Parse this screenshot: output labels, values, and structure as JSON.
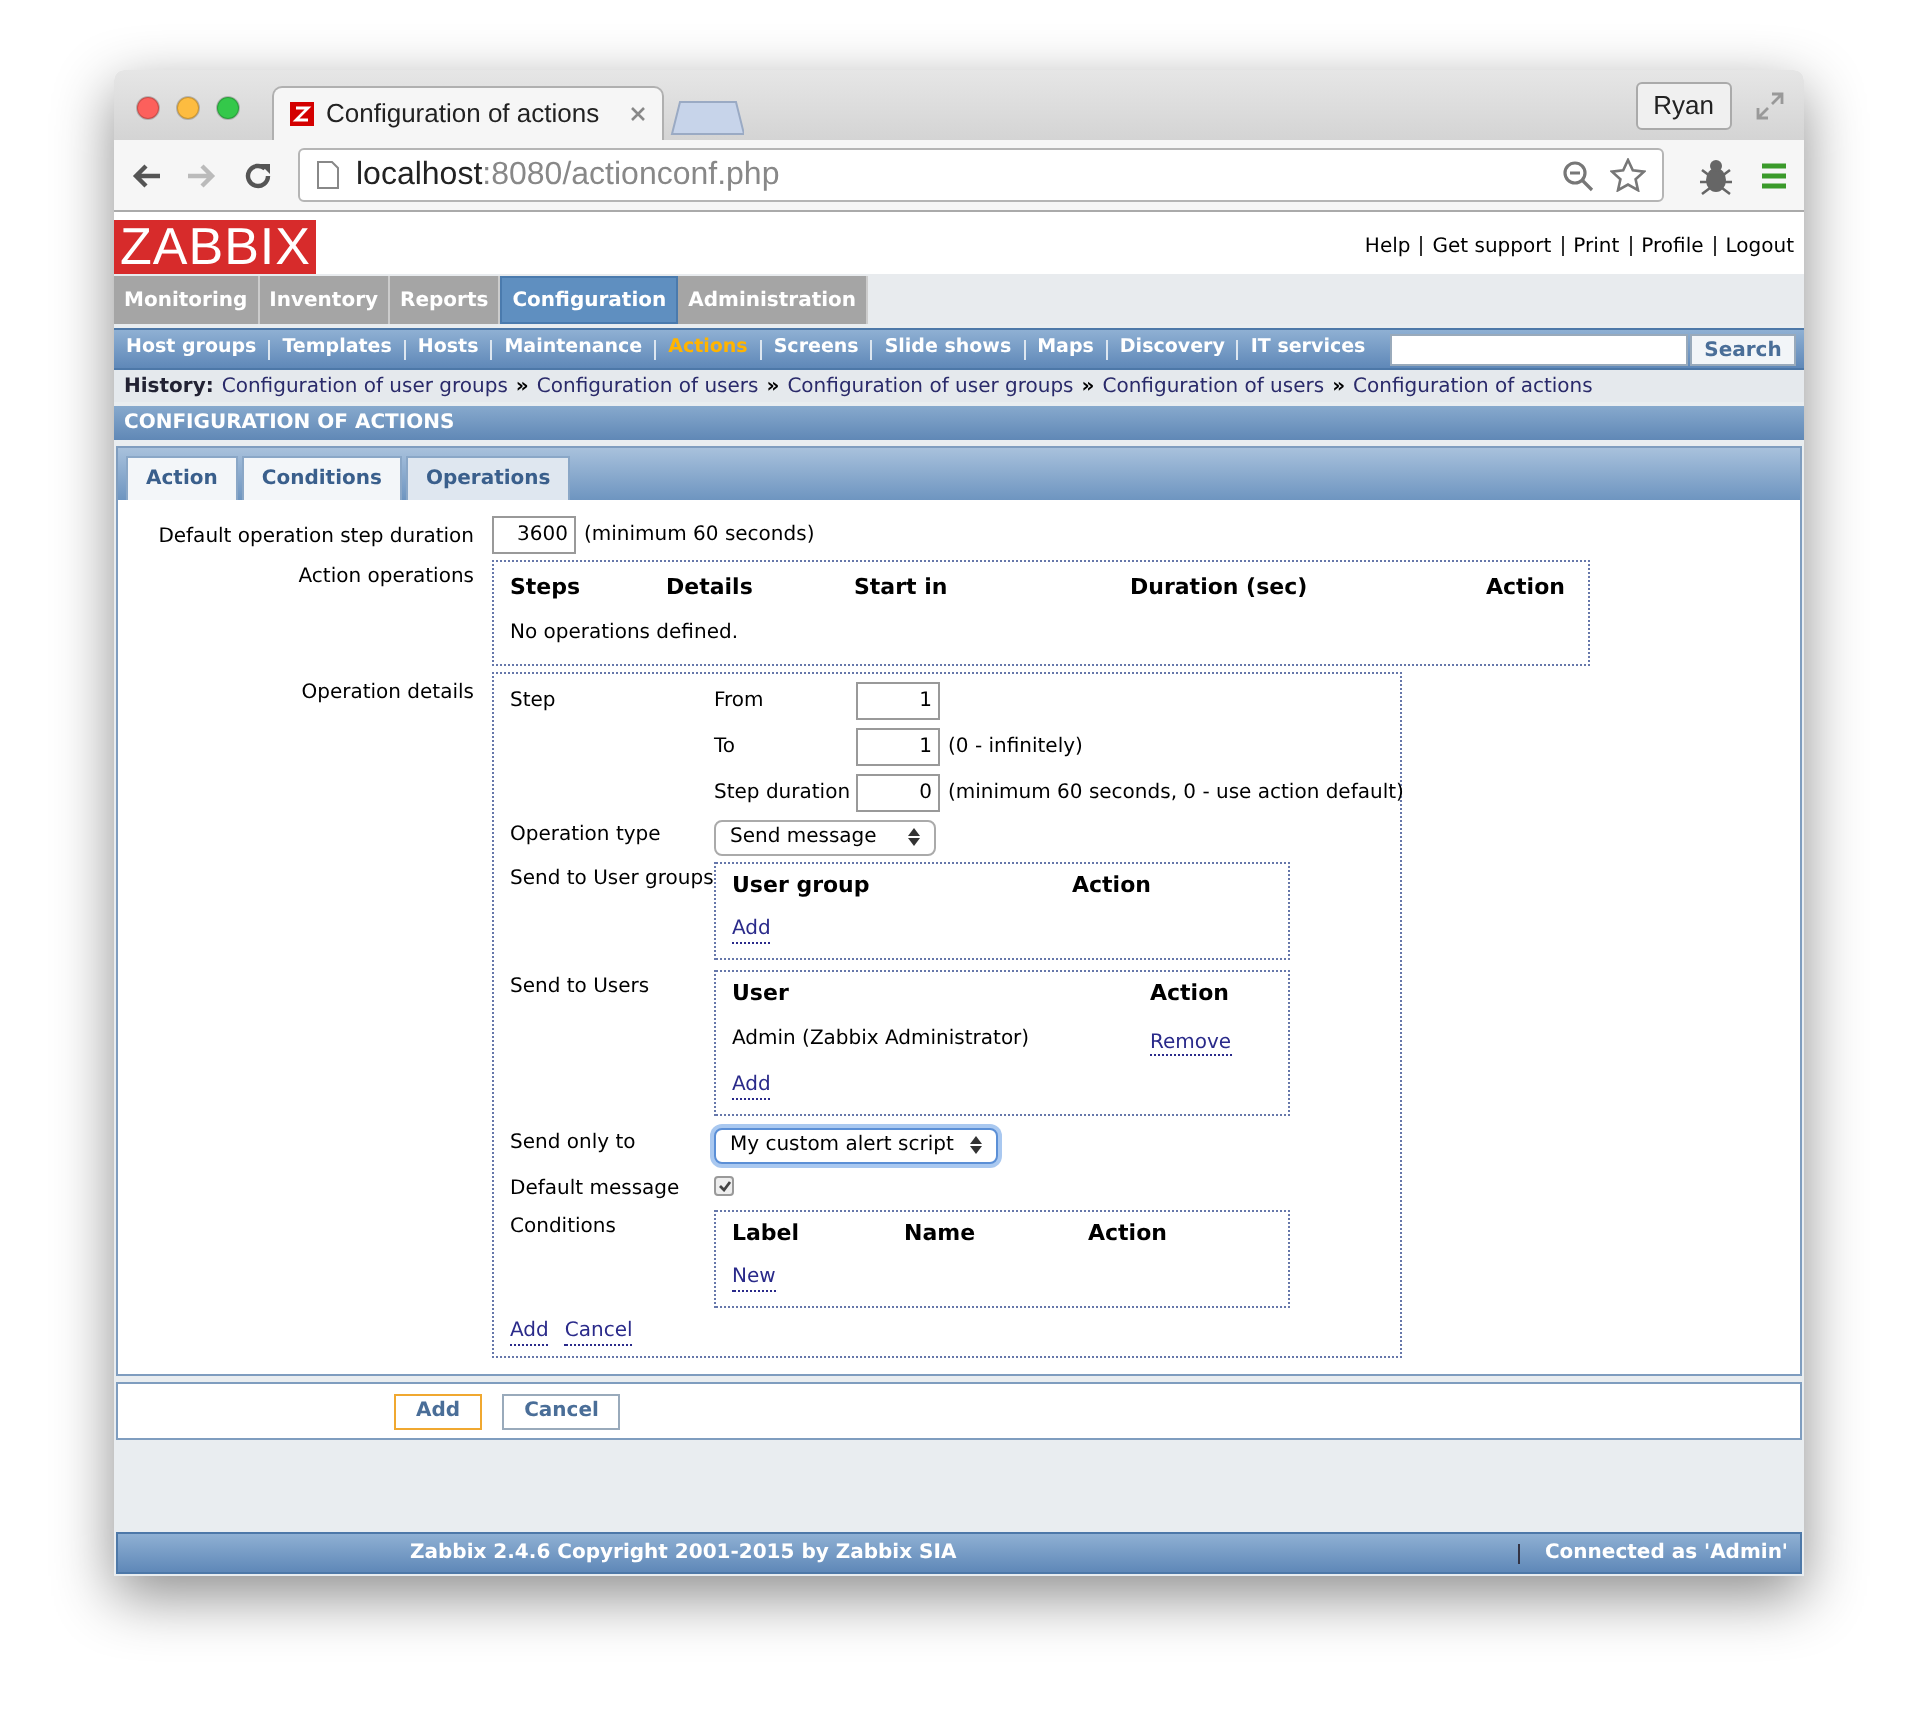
{
  "browser": {
    "tab_title": "Configuration of actions",
    "profile": "Ryan",
    "url_host": "localhost",
    "url_rest": ":8080/actionconf.php"
  },
  "logo": "ZABBIX",
  "header_links": [
    "Help",
    "Get support",
    "Print",
    "Profile",
    "Logout"
  ],
  "main_menu": [
    {
      "label": "Monitoring",
      "selected": false
    },
    {
      "label": "Inventory",
      "selected": false
    },
    {
      "label": "Reports",
      "selected": false
    },
    {
      "label": "Configuration",
      "selected": true
    },
    {
      "label": "Administration",
      "selected": false
    }
  ],
  "sub_menu": [
    {
      "label": "Host groups",
      "selected": false
    },
    {
      "label": "Templates",
      "selected": false
    },
    {
      "label": "Hosts",
      "selected": false
    },
    {
      "label": "Maintenance",
      "selected": false
    },
    {
      "label": "Actions",
      "selected": true
    },
    {
      "label": "Screens",
      "selected": false
    },
    {
      "label": "Slide shows",
      "selected": false
    },
    {
      "label": "Maps",
      "selected": false
    },
    {
      "label": "Discovery",
      "selected": false
    },
    {
      "label": "IT services",
      "selected": false
    }
  ],
  "search_button": "Search",
  "history": {
    "label": "History:",
    "separator": "»",
    "items": [
      "Configuration of user groups",
      "Configuration of users",
      "Configuration of user groups",
      "Configuration of users",
      "Configuration of actions"
    ]
  },
  "page_title": "CONFIGURATION OF ACTIONS",
  "form_tabs": [
    {
      "label": "Action",
      "selected": false
    },
    {
      "label": "Conditions",
      "selected": false
    },
    {
      "label": "Operations",
      "selected": true
    }
  ],
  "default_step": {
    "label": "Default operation step duration",
    "value": "3600",
    "hint": "(minimum 60 seconds)"
  },
  "action_operations": {
    "label": "Action operations",
    "columns": [
      "Steps",
      "Details",
      "Start in",
      "Duration (sec)",
      "Action"
    ],
    "empty": "No operations defined."
  },
  "operation_details": {
    "label": "Operation details",
    "step": {
      "label": "Step",
      "fields": [
        {
          "label": "From",
          "value": "1"
        },
        {
          "label": "To",
          "value": "1",
          "hint": "(0 - infinitely)"
        },
        {
          "label": "Step duration",
          "value": "0",
          "hint": "(minimum 60 seconds, 0 - use action default)"
        }
      ]
    },
    "operation_type": {
      "label": "Operation type",
      "value": "Send message"
    },
    "user_groups": {
      "label": "Send to User groups",
      "columns": [
        "User group",
        "Action"
      ],
      "link": "Add"
    },
    "users": {
      "label": "Send to Users",
      "columns": [
        "User",
        "Action"
      ],
      "rows": [
        {
          "user": "Admin (Zabbix Administrator)",
          "action": "Remove"
        }
      ],
      "link": "Add"
    },
    "send_only_to": {
      "label": "Send only to",
      "value": "My custom alert script",
      "focused": true
    },
    "default_message": {
      "label": "Default message",
      "checked": true
    },
    "conditions": {
      "label": "Conditions",
      "columns": [
        "Label",
        "Name",
        "Action"
      ],
      "link": "New"
    },
    "links": [
      "Add",
      "Cancel"
    ]
  },
  "buttons": [
    {
      "label": "Add",
      "focused": true
    },
    {
      "label": "Cancel",
      "focused": false
    }
  ],
  "footer": {
    "copyright": "Zabbix 2.4.6 Copyright 2001-2015 by Zabbix SIA",
    "connected": "Connected as 'Admin'"
  }
}
